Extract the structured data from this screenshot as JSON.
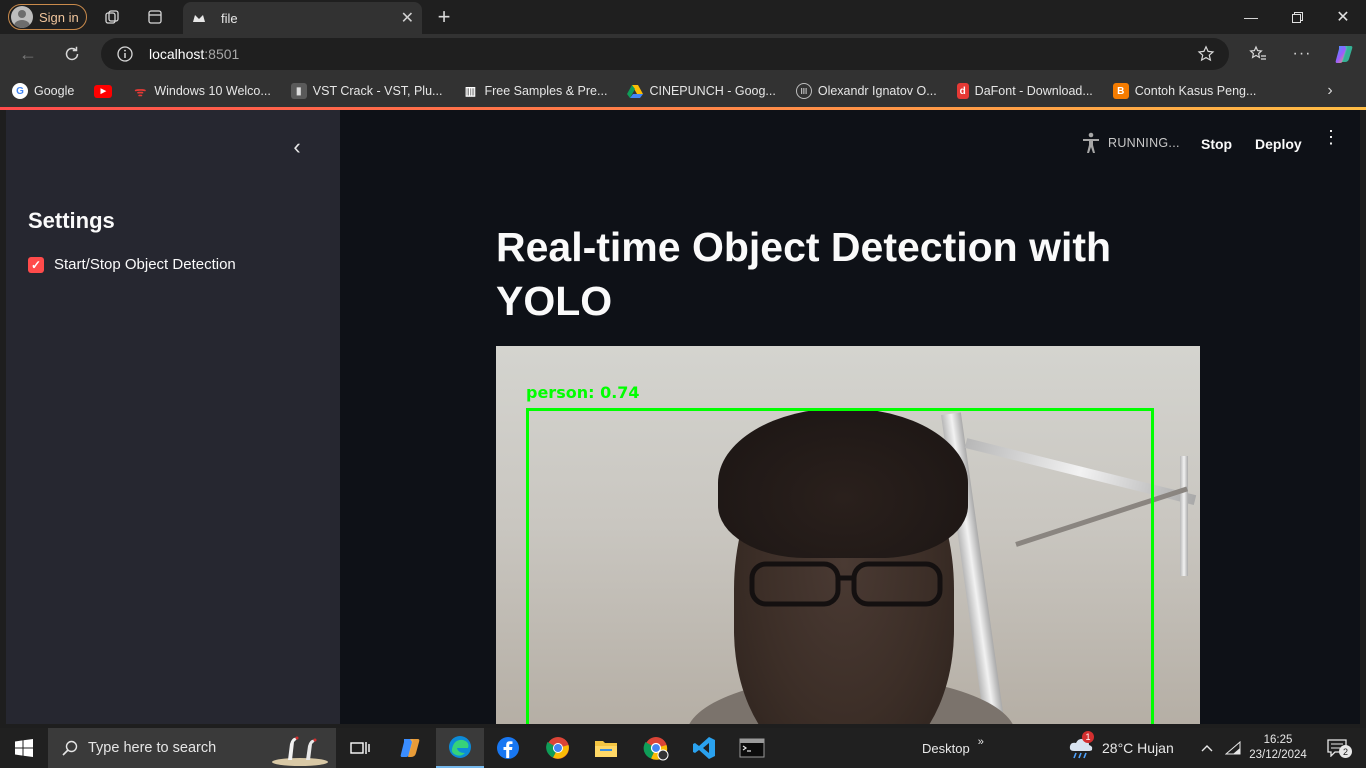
{
  "browser": {
    "signin_label": "Sign in",
    "tab_title": "file",
    "url_host": "localhost",
    "url_port": ":8501"
  },
  "bookmarks": [
    {
      "label": "Google",
      "icon": "google-icon",
      "color": "#4285f4"
    },
    {
      "label": "",
      "icon": "youtube-icon",
      "color": "#ff0000"
    },
    {
      "label": "Windows 10 Welco...",
      "icon": "wifi-icon",
      "color": "#e53935"
    },
    {
      "label": "VST Crack - VST, Plu...",
      "icon": "vst-icon",
      "color": "#9e9e9e"
    },
    {
      "label": "Free Samples & Pre...",
      "icon": "piano-icon",
      "color": "#ffffff"
    },
    {
      "label": "CINEPUNCH - Goog...",
      "icon": "drive-icon",
      "color": "#fbbc04"
    },
    {
      "label": "Olexandr Ignatov O...",
      "icon": "circle-logo-icon",
      "color": "#bdbdbd"
    },
    {
      "label": "DaFont - Download...",
      "icon": "dafont-icon",
      "color": "#e53935"
    },
    {
      "label": "Contoh Kasus Peng...",
      "icon": "blogger-icon",
      "color": "#f57c00"
    }
  ],
  "app": {
    "sidebar_heading": "Settings",
    "checkbox_label": "Start/Stop Object Detection",
    "checkbox_checked": true,
    "status_text": "RUNNING...",
    "stop_label": "Stop",
    "deploy_label": "Deploy",
    "title": "Real-time Object Detection with YOLO",
    "detection_label": "person: 0.74",
    "accent_color": "#ff4b4b",
    "box_color": "#00ff00"
  },
  "taskbar": {
    "search_placeholder": "Type here to search",
    "desktop_label": "Desktop",
    "weather": "28°C  Hujan",
    "time": "16:25",
    "date": "23/12/2024",
    "notifications": "2",
    "weather_badge": "1"
  }
}
